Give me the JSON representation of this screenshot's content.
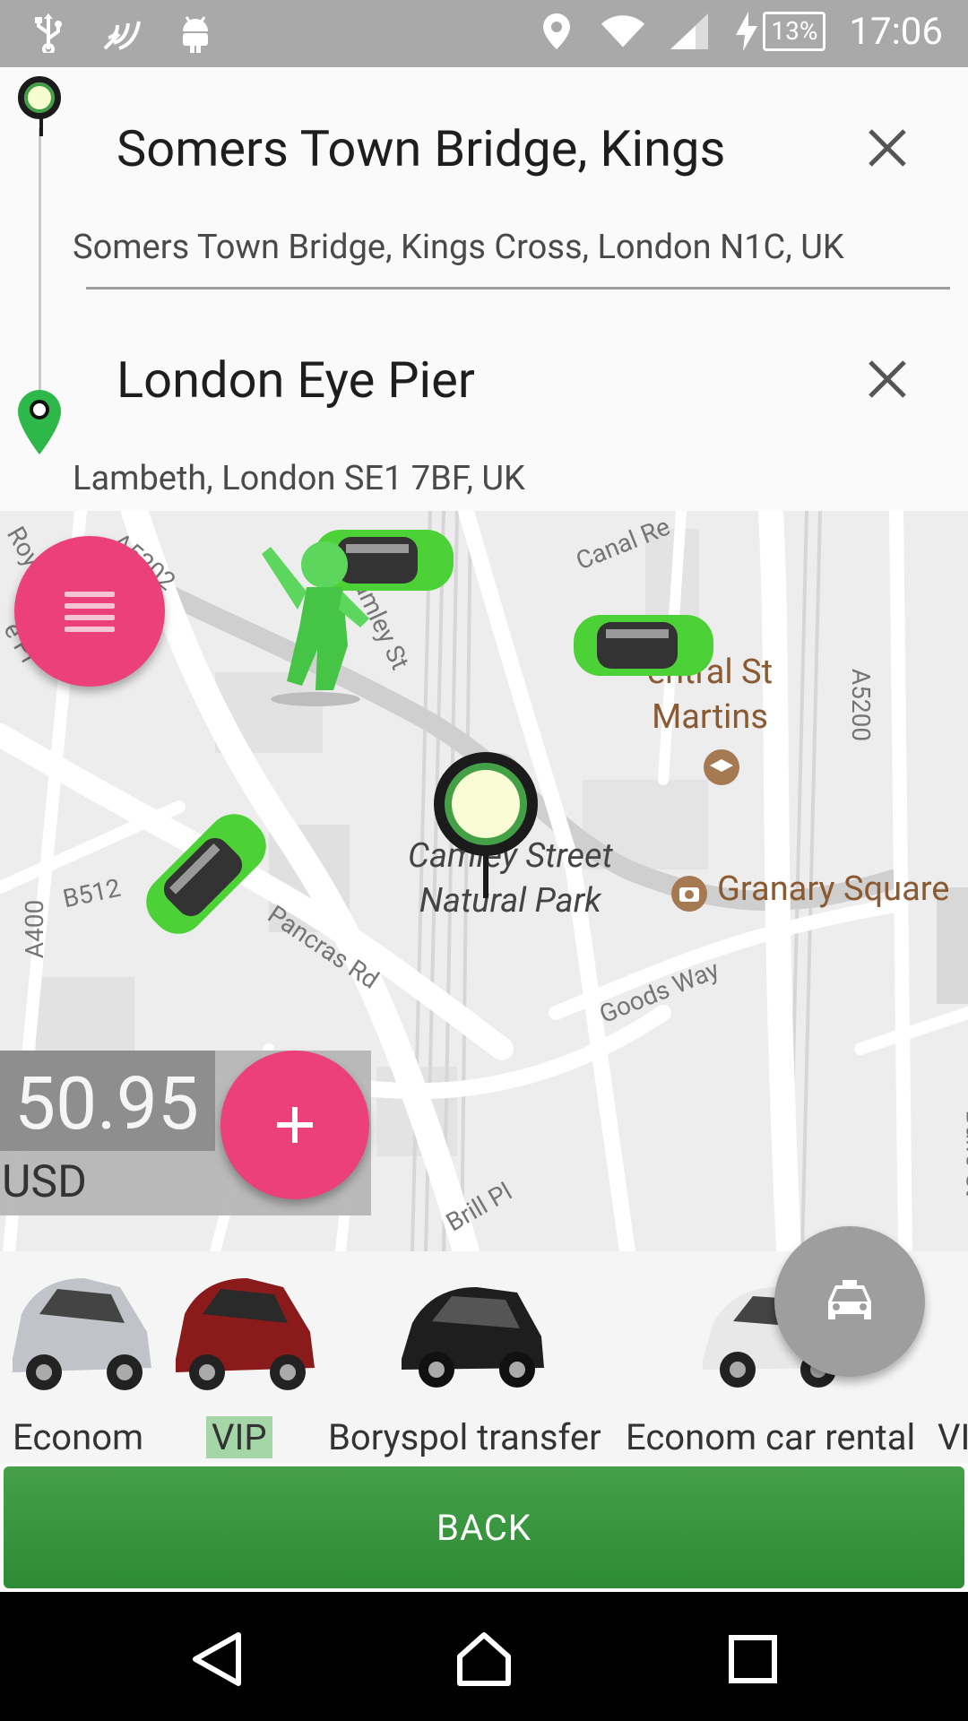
{
  "status_bar": {
    "icons_left": [
      "usb-icon",
      "nfc-icon",
      "android-icon"
    ],
    "icons_right": [
      "location-icon",
      "wifi-icon",
      "cell-signal-icon",
      "charging-icon"
    ],
    "battery": "13%",
    "time": "17:06"
  },
  "route": {
    "origin": {
      "name": "Somers Town Bridge, Kings",
      "address": "Somers Town Bridge, Kings Cross, London N1C, UK"
    },
    "destination": {
      "name": "London Eye Pier",
      "address": "Lambeth, London SE1 7BF, UK"
    }
  },
  "map": {
    "labels": {
      "canal_rd": "Canal Re",
      "a5202": "A5202",
      "royal": "Roya",
      "pl": "e Pl",
      "st": "St",
      "camley_st": "amley St",
      "central_st_martins": "entral St\nMartins",
      "a5200": "A5200",
      "camley_park": "Camley Street\nNatural Park",
      "granary_square": "Granary Square",
      "b512": "B512",
      "pancras_rd": "Pancras Rd",
      "goods_way": "Goods Way",
      "a400": "A400",
      "brill_pl": "Brill Pl",
      "balfe_st": "Balfe St"
    }
  },
  "price": {
    "value": "50.95",
    "currency": "USD"
  },
  "cars": [
    {
      "label": "Econom",
      "selected": false,
      "color": "#c0c4c8"
    },
    {
      "label": "VIP",
      "selected": true,
      "color": "#8b1a1a"
    },
    {
      "label": "Boryspol transfer",
      "selected": false,
      "color": "#1e1e1e"
    },
    {
      "label": "Econom car rental",
      "selected": false,
      "color": "#e8e8e8"
    },
    {
      "label": "VI",
      "selected": false,
      "color": "#000"
    }
  ],
  "buttons": {
    "back": "BACK"
  },
  "colors": {
    "accent": "#ec407a",
    "primary": "#43a047",
    "status_bar": "#a9a9a9"
  }
}
